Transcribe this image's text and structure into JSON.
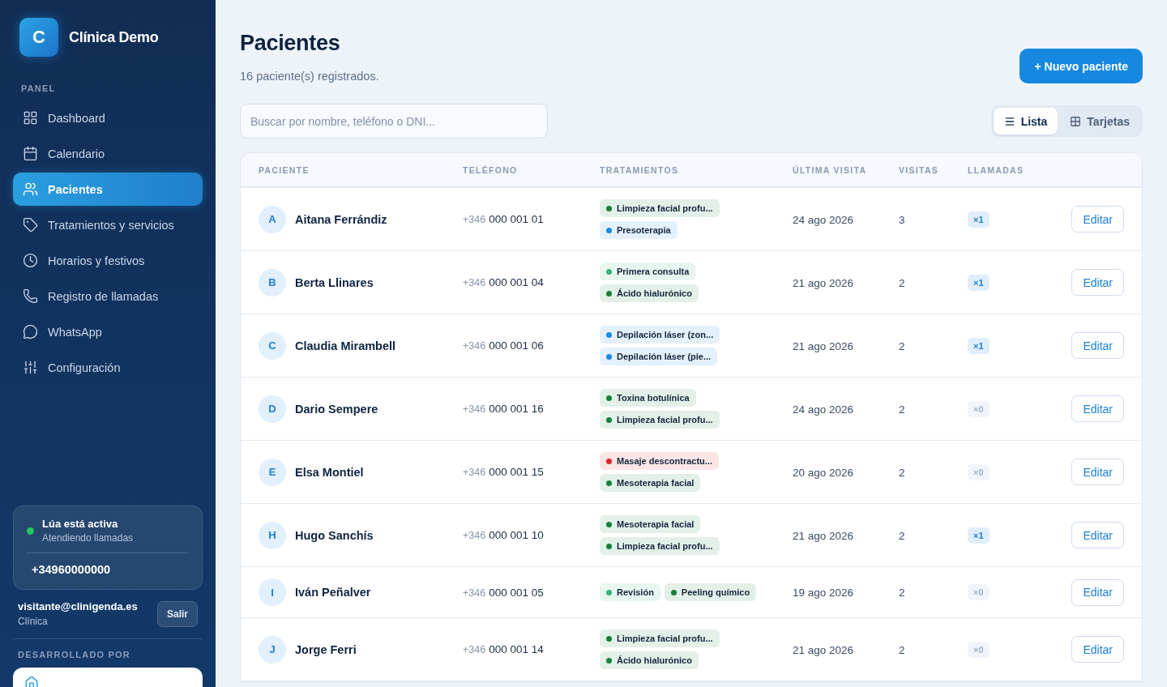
{
  "brand": {
    "logo_letter": "C",
    "name": "Clínica Demo"
  },
  "sidebar": {
    "section": "PANEL",
    "items": [
      {
        "label": "Dashboard",
        "selected": false
      },
      {
        "label": "Calendario",
        "selected": false
      },
      {
        "label": "Pacientes",
        "selected": true
      },
      {
        "label": "Tratamientos y servicios",
        "selected": false
      },
      {
        "label": "Horarios y festivos",
        "selected": false
      },
      {
        "label": "Registro de llamadas",
        "selected": false
      },
      {
        "label": "WhatsApp",
        "selected": false
      },
      {
        "label": "Configuración",
        "selected": false
      }
    ],
    "assistant": {
      "title": "Lúa está activa",
      "subtitle": "Atendiendo llamadas",
      "active": true,
      "phone": "+34960000000"
    },
    "user": {
      "email": "visitante@clinigenda.es",
      "role": "Clínica",
      "logout": "Salir"
    },
    "credit": "DESARROLLADO POR"
  },
  "header": {
    "title": "Pacientes",
    "subtitle": "16 paciente(s) registrados.",
    "new_button": "+ Nuevo paciente"
  },
  "search": {
    "placeholder": "Buscar por nombre, teléfono o DNI..."
  },
  "view_toggle": [
    {
      "label": "Lista",
      "selected": true
    },
    {
      "label": "Tarjetas",
      "selected": false
    }
  ],
  "table": {
    "columns": [
      "PACIENTE",
      "TELÉFONO",
      "TRATAMIENTOS",
      "ÚLTIMA VISITA",
      "VISITAS",
      "LLAMADAS"
    ],
    "rows": [
      {
        "initial": "A",
        "name": "Aitana Ferrándiz",
        "phone_prefix": "+346",
        "phone": "000 001 01",
        "treatments": [
          {
            "label": "Limpieza facial profu...",
            "color": "#15803d"
          },
          {
            "label": "Presoterapia",
            "color": "#1e88e5"
          }
        ],
        "last_visit": "24 ago 2026",
        "visits": "3",
        "calls": "×1",
        "calls_active": true,
        "action": "Editar"
      },
      {
        "initial": "B",
        "name": "Berta Llinares",
        "phone_prefix": "+346",
        "phone": "000 001 04",
        "treatments": [
          {
            "label": "Primera consulta",
            "color": "#34b37a"
          },
          {
            "label": "Ácido hialurónico",
            "color": "#15803d"
          }
        ],
        "last_visit": "21 ago 2026",
        "visits": "2",
        "calls": "×1",
        "calls_active": true,
        "action": "Editar"
      },
      {
        "initial": "C",
        "name": "Claudia Mirambell",
        "phone_prefix": "+346",
        "phone": "000 001 06",
        "treatments": [
          {
            "label": "Depilación láser (zon...",
            "color": "#1e88e5"
          },
          {
            "label": "Depilación láser (pie...",
            "color": "#1e88e5"
          }
        ],
        "last_visit": "21 ago 2026",
        "visits": "2",
        "calls": "×1",
        "calls_active": true,
        "action": "Editar"
      },
      {
        "initial": "D",
        "name": "Dario Sempere",
        "phone_prefix": "+346",
        "phone": "000 001 16",
        "treatments": [
          {
            "label": "Toxina botulínica",
            "color": "#15803d"
          },
          {
            "label": "Limpieza facial profu...",
            "color": "#15803d"
          }
        ],
        "last_visit": "24 ago 2026",
        "visits": "2",
        "calls": "×0",
        "calls_active": false,
        "action": "Editar"
      },
      {
        "initial": "E",
        "name": "Elsa Montiel",
        "phone_prefix": "+346",
        "phone": "000 001 15",
        "treatments": [
          {
            "label": "Masaje descontractu...",
            "color": "#dc2626"
          },
          {
            "label": "Mesoterapia facial",
            "color": "#15803d"
          }
        ],
        "last_visit": "20 ago 2026",
        "visits": "2",
        "calls": "×0",
        "calls_active": false,
        "action": "Editar"
      },
      {
        "initial": "H",
        "name": "Hugo Sanchís",
        "phone_prefix": "+346",
        "phone": "000 001 10",
        "treatments": [
          {
            "label": "Mesoterapia facial",
            "color": "#15803d"
          },
          {
            "label": "Limpieza facial profu...",
            "color": "#15803d"
          }
        ],
        "last_visit": "21 ago 2026",
        "visits": "2",
        "calls": "×1",
        "calls_active": true,
        "action": "Editar"
      },
      {
        "initial": "I",
        "name": "Iván Peñalver",
        "phone_prefix": "+346",
        "phone": "000 001 05",
        "treatments": [
          {
            "label": "Revisión",
            "color": "#34b37a"
          },
          {
            "label": "Peeling químico",
            "color": "#15803d"
          }
        ],
        "last_visit": "19 ago 2026",
        "visits": "2",
        "calls": "×0",
        "calls_active": false,
        "action": "Editar"
      },
      {
        "initial": "J",
        "name": "Jorge Ferri",
        "phone_prefix": "+346",
        "phone": "000 001 14",
        "treatments": [
          {
            "label": "Limpieza facial profu...",
            "color": "#15803d"
          },
          {
            "label": "Ácido hialurónico",
            "color": "#15803d"
          }
        ],
        "last_visit": "21 ago 2026",
        "visits": "2",
        "calls": "×0",
        "calls_active": false,
        "action": "Editar"
      }
    ]
  }
}
